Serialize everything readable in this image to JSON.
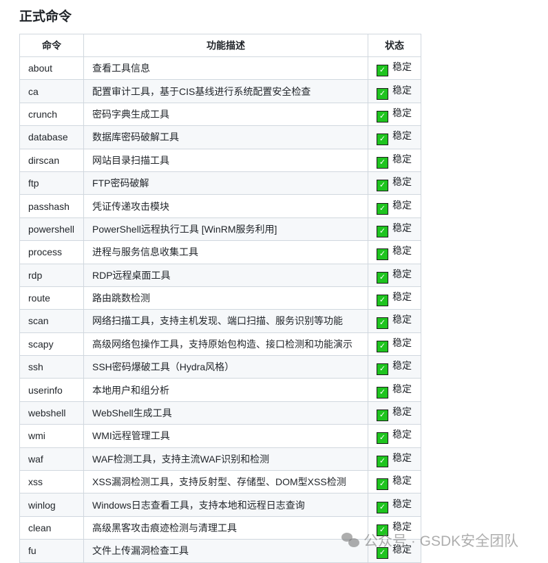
{
  "title": "正式命令",
  "headers": [
    "命令",
    "功能描述",
    "状态"
  ],
  "rows": [
    [
      "about",
      "查看工具信息",
      "稳定"
    ],
    [
      "ca",
      "配置审计工具，基于CIS基线进行系统配置安全检查",
      "稳定"
    ],
    [
      "crunch",
      "密码字典生成工具",
      "稳定"
    ],
    [
      "database",
      "数据库密码破解工具",
      "稳定"
    ],
    [
      "dirscan",
      "网站目录扫描工具",
      "稳定"
    ],
    [
      "ftp",
      "FTP密码破解",
      "稳定"
    ],
    [
      "passhash",
      "凭证传递攻击模块",
      "稳定"
    ],
    [
      "powershell",
      "PowerShell远程执行工具 [WinRM服务利用]",
      "稳定"
    ],
    [
      "process",
      "进程与服务信息收集工具",
      "稳定"
    ],
    [
      "rdp",
      "RDP远程桌面工具",
      "稳定"
    ],
    [
      "route",
      "路由跳数检测",
      "稳定"
    ],
    [
      "scan",
      "网络扫描工具，支持主机发现、端口扫描、服务识别等功能",
      "稳定"
    ],
    [
      "scapy",
      "高级网络包操作工具，支持原始包构造、接口检测和功能演示",
      "稳定"
    ],
    [
      "ssh",
      "SSH密码爆破工具（Hydra风格）",
      "稳定"
    ],
    [
      "userinfo",
      "本地用户和组分析",
      "稳定"
    ],
    [
      "webshell",
      "WebShell生成工具",
      "稳定"
    ],
    [
      "wmi",
      "WMI远程管理工具",
      "稳定"
    ],
    [
      "waf",
      "WAF检测工具，支持主流WAF识别和检测",
      "稳定"
    ],
    [
      "xss",
      "XSS漏洞检测工具，支持反射型、存储型、DOM型XSS检测",
      "稳定"
    ],
    [
      "winlog",
      "Windows日志查看工具，支持本地和远程日志查询",
      "稳定"
    ],
    [
      "clean",
      "高级黑客攻击痕迹检测与清理工具",
      "稳定"
    ],
    [
      "fu",
      "文件上传漏洞检查工具",
      "稳定"
    ]
  ],
  "watermark": "公众号 · GSDK安全团队"
}
